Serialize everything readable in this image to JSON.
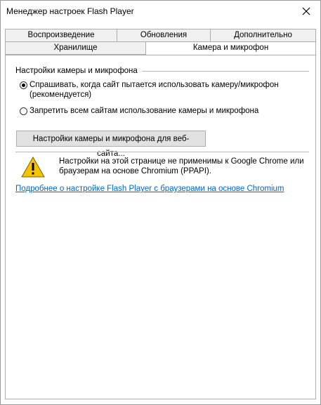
{
  "window": {
    "title": "Менеджер настроек Flash Player"
  },
  "tabs": {
    "row1": [
      {
        "label": "Воспроизведение"
      },
      {
        "label": "Обновления"
      },
      {
        "label": "Дополнительно"
      }
    ],
    "row2": [
      {
        "label": "Хранилище"
      },
      {
        "label": "Камера и микрофон",
        "active": true
      }
    ]
  },
  "panel": {
    "group_title": "Настройки камеры и микрофона",
    "options": [
      {
        "label_line1": "Спрашивать, когда сайт пытается использовать камеру/микрофон",
        "label_line2": "(рекомендуется)",
        "checked": true
      },
      {
        "label_line1": "Запретить всем сайтам использование камеры и микрофона",
        "checked": false
      }
    ],
    "site_button_label": "Настройки камеры и микрофона для веб-сайта...",
    "warning_line1": "Настройки на этой странице не применимы к Google Chrome или",
    "warning_line2": "браузерам на основе Chromium (PPAPI).",
    "link_text": "Подробнее о настройке Flash Player с браузерами на основе Chromium"
  },
  "icons": {
    "close": "close-icon",
    "warning": "warning-icon"
  },
  "colors": {
    "link": "#0066cc",
    "warning_fill": "#f5c400",
    "button_bg": "#e1e1e1",
    "tab_bg": "#f0f0f0"
  }
}
